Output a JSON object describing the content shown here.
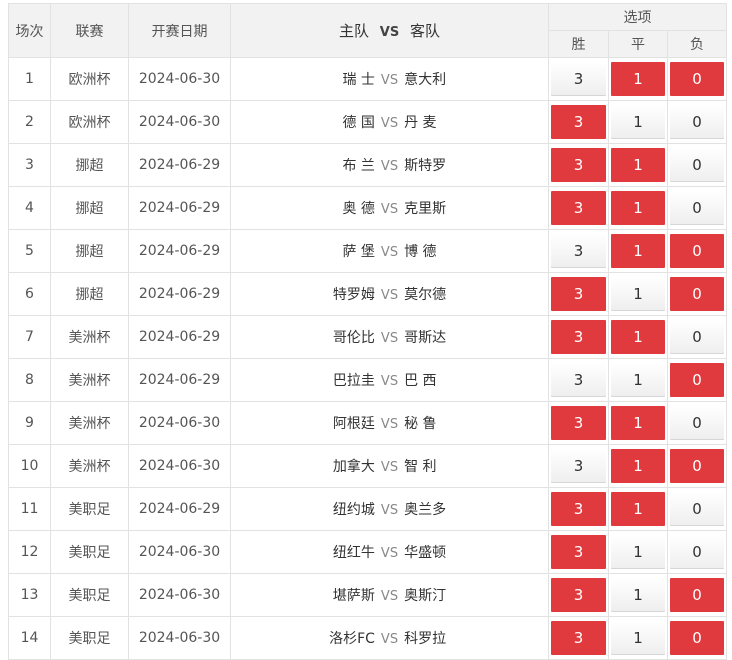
{
  "headers": {
    "match_no": "场次",
    "league": "联赛",
    "date": "开赛日期",
    "home": "主队",
    "vs": "VS",
    "away": "客队",
    "options": "选项",
    "win": "胜",
    "draw": "平",
    "lose": "负"
  },
  "rows": [
    {
      "no": "1",
      "league": "欧洲杯",
      "date": "2024-06-30",
      "home": "瑞 士",
      "vs": "VS",
      "away": "意大利",
      "win": "3",
      "draw": "1",
      "lose": "0",
      "sel": [
        false,
        true,
        true
      ]
    },
    {
      "no": "2",
      "league": "欧洲杯",
      "date": "2024-06-30",
      "home": "德 国",
      "vs": "VS",
      "away": "丹 麦",
      "win": "3",
      "draw": "1",
      "lose": "0",
      "sel": [
        true,
        false,
        false
      ]
    },
    {
      "no": "3",
      "league": "挪超",
      "date": "2024-06-29",
      "home": "布 兰",
      "vs": "VS",
      "away": "斯特罗",
      "win": "3",
      "draw": "1",
      "lose": "0",
      "sel": [
        true,
        true,
        false
      ]
    },
    {
      "no": "4",
      "league": "挪超",
      "date": "2024-06-29",
      "home": "奥 德",
      "vs": "VS",
      "away": "克里斯",
      "win": "3",
      "draw": "1",
      "lose": "0",
      "sel": [
        true,
        true,
        false
      ]
    },
    {
      "no": "5",
      "league": "挪超",
      "date": "2024-06-29",
      "home": "萨 堡",
      "vs": "VS",
      "away": "博 德",
      "win": "3",
      "draw": "1",
      "lose": "0",
      "sel": [
        false,
        true,
        true
      ]
    },
    {
      "no": "6",
      "league": "挪超",
      "date": "2024-06-29",
      "home": "特罗姆",
      "vs": "VS",
      "away": "莫尔德",
      "win": "3",
      "draw": "1",
      "lose": "0",
      "sel": [
        true,
        false,
        true
      ]
    },
    {
      "no": "7",
      "league": "美洲杯",
      "date": "2024-06-29",
      "home": "哥伦比",
      "vs": "VS",
      "away": "哥斯达",
      "win": "3",
      "draw": "1",
      "lose": "0",
      "sel": [
        true,
        true,
        false
      ]
    },
    {
      "no": "8",
      "league": "美洲杯",
      "date": "2024-06-29",
      "home": "巴拉圭",
      "vs": "VS",
      "away": "巴 西",
      "win": "3",
      "draw": "1",
      "lose": "0",
      "sel": [
        false,
        false,
        true
      ]
    },
    {
      "no": "9",
      "league": "美洲杯",
      "date": "2024-06-30",
      "home": "阿根廷",
      "vs": "VS",
      "away": "秘 鲁",
      "win": "3",
      "draw": "1",
      "lose": "0",
      "sel": [
        true,
        true,
        false
      ]
    },
    {
      "no": "10",
      "league": "美洲杯",
      "date": "2024-06-30",
      "home": "加拿大",
      "vs": "VS",
      "away": "智 利",
      "win": "3",
      "draw": "1",
      "lose": "0",
      "sel": [
        false,
        true,
        true
      ]
    },
    {
      "no": "11",
      "league": "美职足",
      "date": "2024-06-29",
      "home": "纽约城",
      "vs": "VS",
      "away": "奥兰多",
      "win": "3",
      "draw": "1",
      "lose": "0",
      "sel": [
        true,
        true,
        false
      ]
    },
    {
      "no": "12",
      "league": "美职足",
      "date": "2024-06-30",
      "home": "纽红牛",
      "vs": "VS",
      "away": "华盛顿",
      "win": "3",
      "draw": "1",
      "lose": "0",
      "sel": [
        true,
        false,
        false
      ]
    },
    {
      "no": "13",
      "league": "美职足",
      "date": "2024-06-30",
      "home": "堪萨斯",
      "vs": "VS",
      "away": "奥斯汀",
      "win": "3",
      "draw": "1",
      "lose": "0",
      "sel": [
        true,
        false,
        true
      ]
    },
    {
      "no": "14",
      "league": "美职足",
      "date": "2024-06-30",
      "home": "洛杉FC",
      "vs": "VS",
      "away": "科罗拉",
      "win": "3",
      "draw": "1",
      "lose": "0",
      "sel": [
        true,
        false,
        true
      ]
    }
  ],
  "colors": {
    "selected": "#e03a3e",
    "header_bg": "#f2f2f2",
    "border": "#e2e2e2"
  }
}
